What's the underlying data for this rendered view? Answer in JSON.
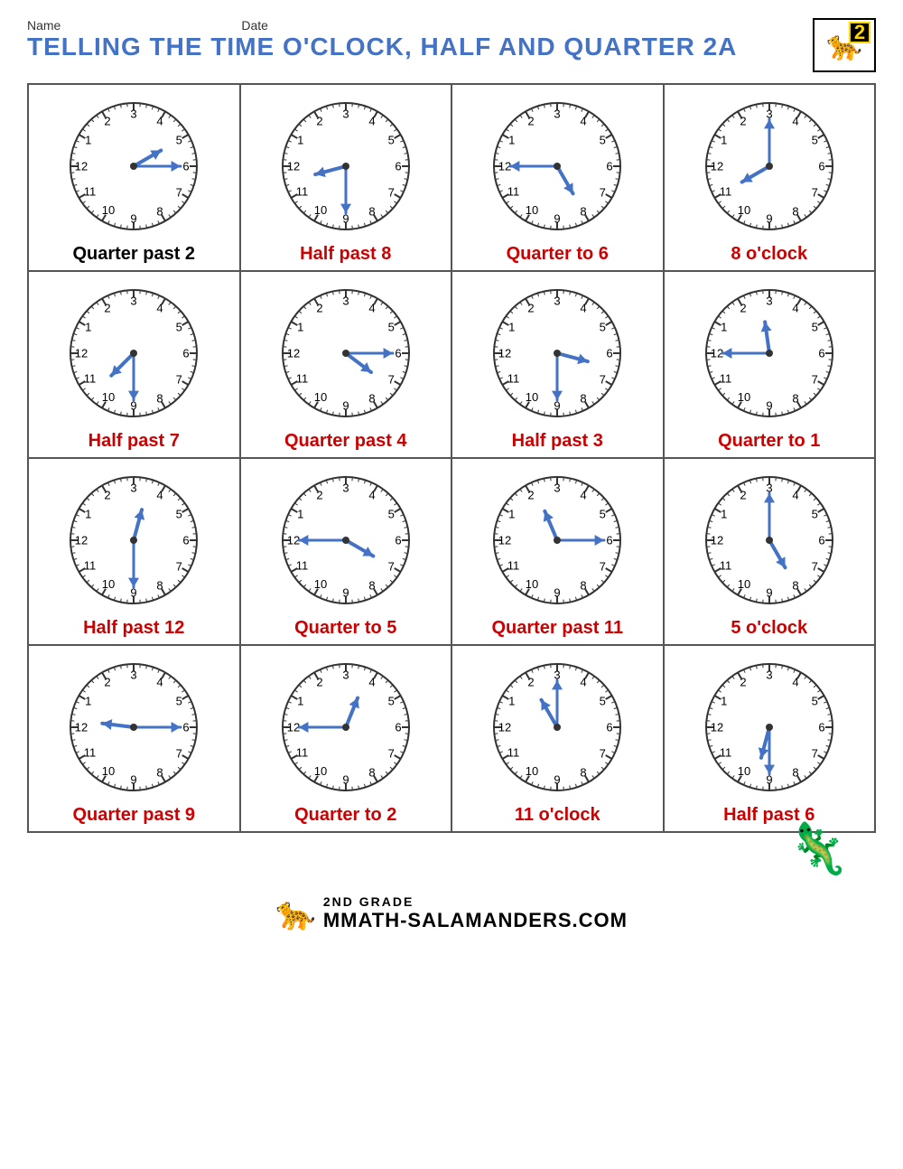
{
  "header": {
    "name_label": "Name",
    "date_label": "Date",
    "title": "TELLING THE TIME O'CLOCK, HALF AND QUARTER 2A",
    "logo_number": "2"
  },
  "clocks": [
    {
      "label": "Quarter past 2",
      "label_color": "black",
      "minute_angle": 90,
      "hour_angle": 60,
      "description": "minute hand points right (3), hour hand points to 2.25"
    },
    {
      "label": "Half past 8",
      "label_color": "red",
      "minute_angle": 180,
      "hour_angle": 255,
      "description": "minute at 6, hour between 8 and 9"
    },
    {
      "label": "Quarter to 6",
      "label_color": "red",
      "minute_angle": 270,
      "hour_angle": 150,
      "description": "minute at 9, hour between 5 and 6"
    },
    {
      "label": "8 o'clock",
      "label_color": "red",
      "minute_angle": 0,
      "hour_angle": 240,
      "description": "minute at 12, hour at 8"
    },
    {
      "label": "Half past 7",
      "label_color": "red",
      "minute_angle": 180,
      "hour_angle": 225,
      "description": "minute at 6, hour between 7 and 8"
    },
    {
      "label": "Quarter past 4",
      "label_color": "red",
      "minute_angle": 90,
      "hour_angle": 127,
      "description": "minute at 3, hour at 4.25"
    },
    {
      "label": "Half past 3",
      "label_color": "red",
      "minute_angle": 180,
      "hour_angle": 105,
      "description": "minute at 6, hour between 3 and 4"
    },
    {
      "label": "Quarter to 1",
      "label_color": "red",
      "minute_angle": 270,
      "hour_angle": 352,
      "description": "minute at 9, hour near 12"
    },
    {
      "label": "Half past 12",
      "label_color": "red",
      "minute_angle": 180,
      "hour_angle": 15,
      "description": "minute at 6, hour between 12 and 1"
    },
    {
      "label": "Quarter to 5",
      "label_color": "red",
      "minute_angle": 270,
      "hour_angle": 120,
      "description": "minute at 9, hour between 4 and 5"
    },
    {
      "label": "Quarter past 11",
      "label_color": "red",
      "minute_angle": 90,
      "hour_angle": 337,
      "description": "minute at 3, hour just past 11"
    },
    {
      "label": "5 o'clock",
      "label_color": "red",
      "minute_angle": 0,
      "hour_angle": 150,
      "description": "minute at 12, hour at 5"
    },
    {
      "label": "Quarter past 9",
      "label_color": "red",
      "minute_angle": 90,
      "hour_angle": 277,
      "description": "minute at 3, hour just past 9"
    },
    {
      "label": "Quarter to 2",
      "label_color": "red",
      "minute_angle": 270,
      "hour_angle": 22,
      "description": "minute at 9, hour between 1 and 2"
    },
    {
      "label": "11 o'clock",
      "label_color": "red",
      "minute_angle": 0,
      "hour_angle": 330,
      "description": "minute at 12, hour at 11"
    },
    {
      "label": "Half past 6",
      "label_color": "red",
      "minute_angle": 180,
      "hour_angle": 195,
      "description": "minute at 6, hour between 6 and 7"
    }
  ],
  "footer": {
    "grade": "2ND GRADE",
    "site": "MATH-SALAMANDERS.COM"
  }
}
